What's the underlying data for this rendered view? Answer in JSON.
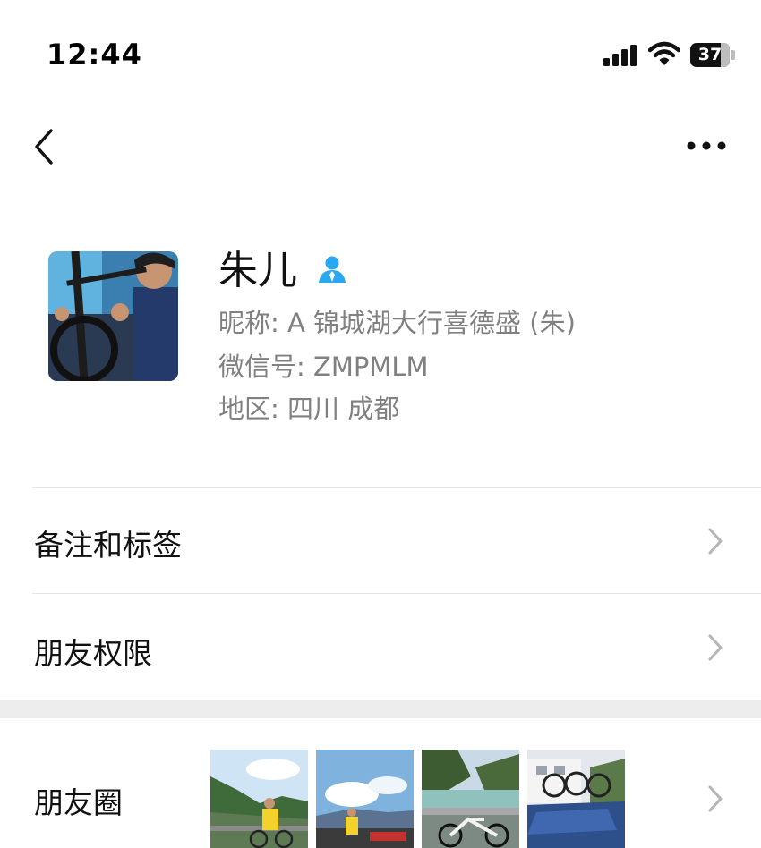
{
  "status_bar": {
    "time": "12:44",
    "battery": "37"
  },
  "nav": {
    "back_icon": "chevron-left-icon",
    "more_icon": "ellipsis-icon"
  },
  "profile": {
    "name": "朱儿",
    "nickname": "昵称: A 锦城湖大行喜德盛 (朱)",
    "wechat_id": "微信号: ZMPMLM",
    "region": "地区: 四川 成都",
    "badge_color": "#2aa7ee"
  },
  "menu": [
    {
      "label": "备注和标签"
    },
    {
      "label": "朋友权限"
    }
  ],
  "moments": {
    "label": "朋友圈"
  }
}
